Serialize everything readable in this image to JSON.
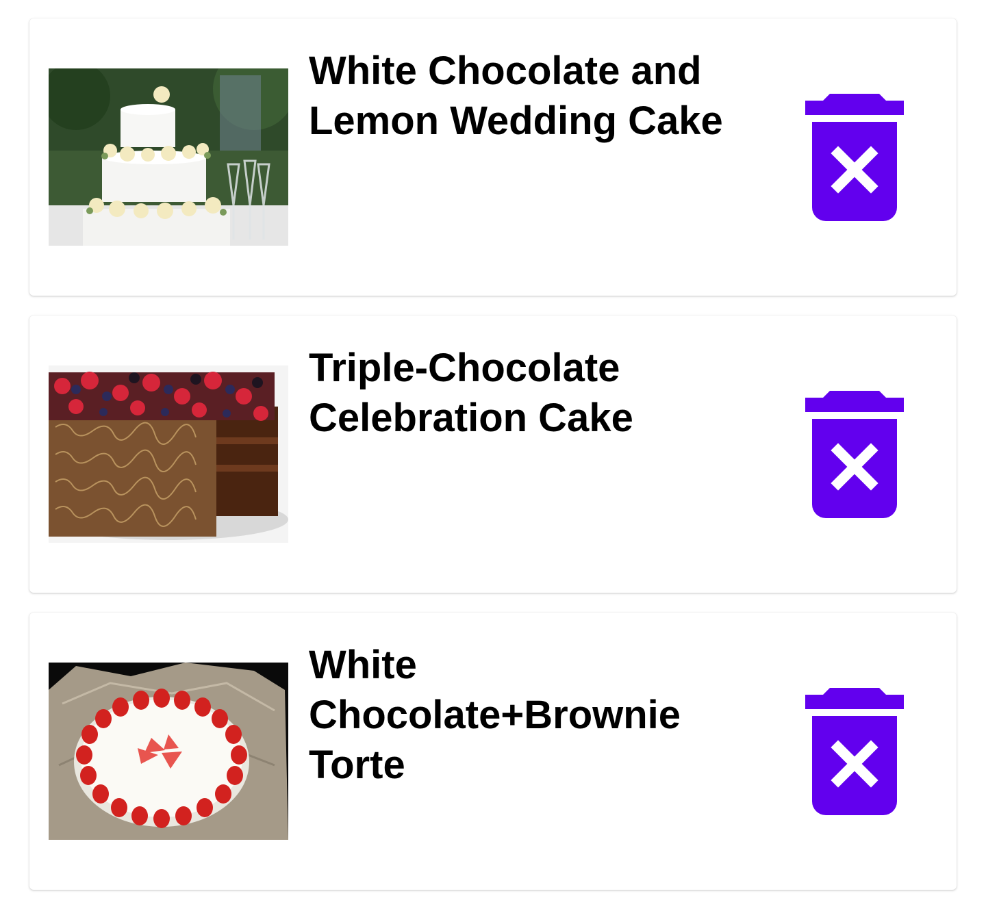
{
  "accent_color": "#6200EE",
  "recipes": [
    {
      "title": "White Chocolate and Lemon Wedding Cake",
      "image_icon": "wedding-cake-photo",
      "delete_icon": "delete-forever-icon"
    },
    {
      "title": "Triple-Chocolate Celebration Cake",
      "image_icon": "berry-chocolate-cake-photo",
      "delete_icon": "delete-forever-icon"
    },
    {
      "title": "White Chocolate+Brownie Torte",
      "image_icon": "strawberry-torte-photo",
      "delete_icon": "delete-forever-icon"
    }
  ]
}
